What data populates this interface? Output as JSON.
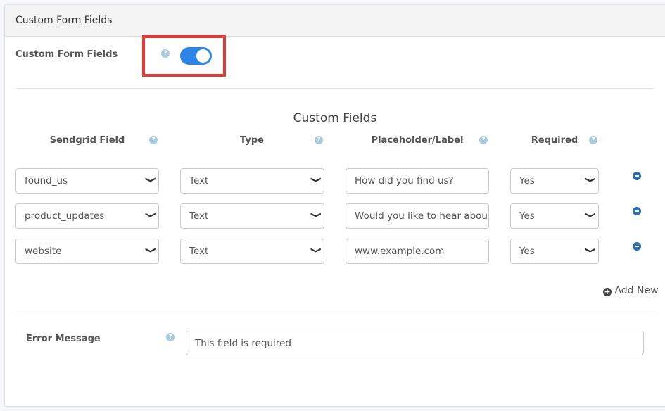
{
  "panel": {
    "title": "Custom Form Fields"
  },
  "toggle": {
    "label": "Custom Form Fields",
    "enabled": true,
    "help": "?"
  },
  "section_title": "Custom Fields",
  "columns": [
    "Sendgrid Field",
    "Type",
    "Placeholder/Label",
    "Required"
  ],
  "rows": [
    {
      "field": "found_us",
      "type": "Text",
      "placeholder": "How did you find us?",
      "required": "Yes"
    },
    {
      "field": "product_updates",
      "type": "Text",
      "placeholder": "Would you like to hear about",
      "required": "Yes"
    },
    {
      "field": "website",
      "type": "Text",
      "placeholder": "www.example.com",
      "required": "Yes"
    }
  ],
  "add_new": "Add New",
  "error": {
    "label": "Error Message",
    "value": "This field is required"
  },
  "colors": {
    "accent": "#2d83e6",
    "highlight": "#e53935"
  }
}
